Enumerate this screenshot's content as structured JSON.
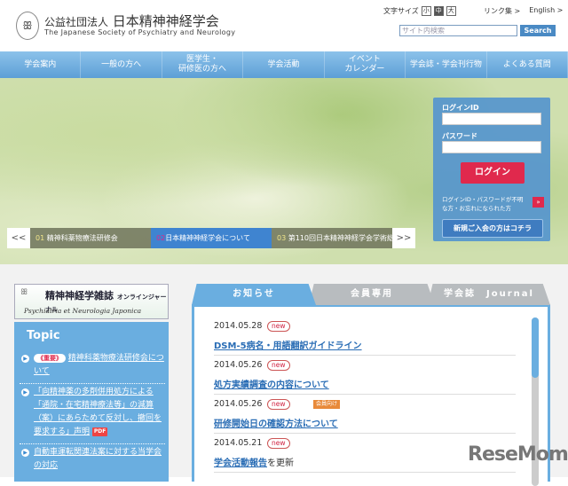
{
  "header": {
    "logo_mark": "ꕥ",
    "org_prefix": "公益社団法人",
    "org_name": "日本精神神経学会",
    "org_en": "The Japanese Society of Psychiatry and Neurology",
    "font_size_label": "文字サイズ",
    "font_sizes": [
      "小",
      "中",
      "大"
    ],
    "links": [
      "リンク集 >",
      "English >"
    ],
    "search_placeholder": "サイト内検索",
    "search_button": "Search"
  },
  "nav": [
    "学会案内",
    "一般の方へ",
    "医学生・\n研修医の方へ",
    "学会活動",
    "イベント\nカレンダー",
    "学会誌・学会刊行物",
    "よくある質問"
  ],
  "login": {
    "id_label": "ログインID",
    "pw_label": "パスワード",
    "button": "ログイン",
    "forgot": "ログインID・パスワードが不明な方・お忘れになられた方",
    "forgot_arrow": "»",
    "register": "新規ご入会の方はコチラ"
  },
  "carousel": {
    "prev": "<<",
    "next": ">>",
    "items": [
      {
        "num": "01",
        "label": "精神科薬物療法研修会"
      },
      {
        "num": "02",
        "label": "日本精神神経学会について"
      },
      {
        "num": "03",
        "label": "第110回日本精神神経学会学術総会"
      }
    ]
  },
  "journal": {
    "title": "精神神経学雑誌",
    "sub": "オンラインジャーナル",
    "latin": "Psychiatria et Neurologia Japonica"
  },
  "topic": {
    "heading": "Topic",
    "items": [
      {
        "badge": "《重要》",
        "text": "精神科薬物療法研修会について"
      },
      {
        "text": "「向精神薬の多剤併用処方による「通院・在宅精神療法等」の減算（案）にあらためて反対し、撤回を要求する」声明",
        "pdf": "PDF"
      },
      {
        "text": "自動車運転関連法案に対する当学会の対応"
      }
    ]
  },
  "tabs": [
    "お知らせ",
    "会員専用",
    "学会誌　Journal"
  ],
  "news": [
    {
      "date": "2014.05.28",
      "new": "new",
      "title": "DSM-5病名・用語翻訳ガイドライン"
    },
    {
      "date": "2014.05.26",
      "new": "new",
      "title": "処方実績調査の内容について"
    },
    {
      "date": "2014.05.26",
      "new": "new",
      "member": "会員向け",
      "title": "研修開始日の確認方法について"
    },
    {
      "date": "2014.05.21",
      "new": "new",
      "title": "学会活動報告",
      "suffix": "を更新"
    }
  ],
  "watermark": "ReseMom"
}
